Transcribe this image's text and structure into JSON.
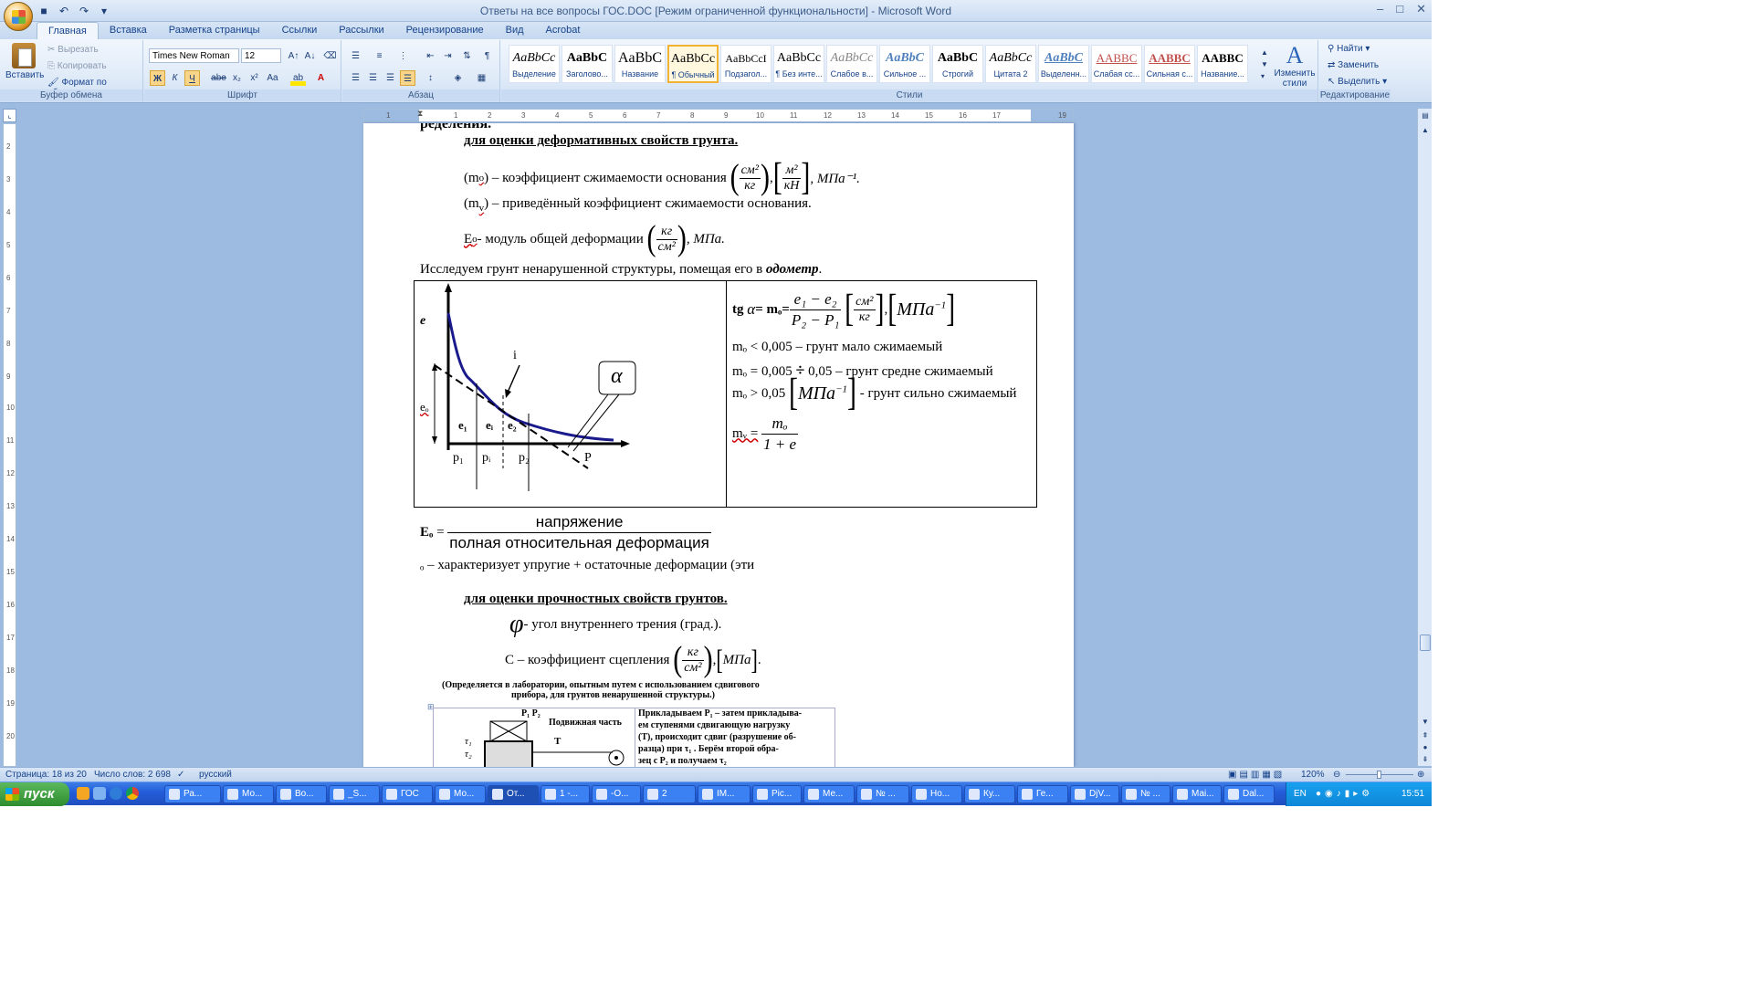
{
  "window": {
    "title": "Ответы на все вопросы ГОС.DOC [Режим ограниченной функциональности] - Microsoft Word"
  },
  "tabs": [
    "Главная",
    "Вставка",
    "Разметка страницы",
    "Ссылки",
    "Рассылки",
    "Рецензирование",
    "Вид",
    "Acrobat"
  ],
  "clipboard": {
    "paste": "Вставить",
    "cut": "Вырезать",
    "copy": "Копировать",
    "format": "Формат по образцу",
    "title": "Буфер обмена"
  },
  "font": {
    "name": "Times New Roman",
    "size": "12",
    "title": "Шрифт",
    "bold": "Ж",
    "italic": "К",
    "underline": "Ч",
    "strike": "abe",
    "sub": "x₂",
    "sup": "x²",
    "case": "Aa"
  },
  "paragraph": {
    "title": "Абзац"
  },
  "styles": {
    "title": "Стили",
    "items": [
      {
        "preview": "AaBbCc",
        "name": "Выделение"
      },
      {
        "preview": "AaBbC",
        "name": "Заголово..."
      },
      {
        "preview": "AaBbC",
        "name": "Название"
      },
      {
        "preview": "AaBbCc",
        "name": "¶ Обычный"
      },
      {
        "preview": "AaBbCcI",
        "name": "Подзагол..."
      },
      {
        "preview": "AaBbCc",
        "name": "¶ Без инте..."
      },
      {
        "preview": "AaBbCc",
        "name": "Слабое в..."
      },
      {
        "preview": "AaBbC",
        "name": "Сильное ..."
      },
      {
        "preview": "AaBbC",
        "name": "Строгий"
      },
      {
        "preview": "AaBbCc",
        "name": "Цитата 2"
      },
      {
        "preview": "AaBbC",
        "name": "Выделенн..."
      },
      {
        "preview": "AABBC",
        "name": "Слабая сс..."
      },
      {
        "preview": "AABBC",
        "name": "Сильная с..."
      },
      {
        "preview": "AABBC",
        "name": "Название..."
      }
    ],
    "change": "Изменить стили"
  },
  "editing": {
    "find": "Найти",
    "replace": "Заменить",
    "select": "Выделить",
    "title": "Редактирование"
  },
  "doc": {
    "top_cut": "ределения.",
    "h_deform": "для оценки деформативных свойств грунта.",
    "m0": "(m",
    "m0_sub": "o",
    "m0_text": ") – коэффициент сжимаемости основания",
    "u_sm2": "см²",
    "u_kg": "кг",
    "u_m2": "м²",
    "u_kn": "кН",
    "mpa_inv": ", МПа⁻¹.",
    "mv": "(m",
    "mv_sub": "v",
    "mv_text": ") – приведённый коэффициент сжимаемости основания.",
    "e0": "E",
    "e0_sub": "o",
    "e0_text": " - модуль общей деформации",
    "mpa": ", МПа.",
    "study": "Исследуем грунт ненарушенной структуры, помещая его в ",
    "odometer": "одометр",
    "fig_e": "e",
    "fig_i": "i",
    "fig_e0": "eₒ",
    "fig_e1": "e₁",
    "fig_ei": "eᵢ",
    "fig_e2": "e₂",
    "fig_p1": "p₁",
    "fig_pi": "pᵢ",
    "fig_p2": "p₂",
    "fig_P": "P",
    "fig_alpha": "α",
    "tg": "tg",
    "alpha": "α",
    "eq_m0": " = mₒ=",
    "f_num": "e₁ − e₂",
    "f_den": "P₂ − P₁",
    "r1": "mₒ < 0,005 – грунт мало сжимаемый",
    "r2a": "mₒ = 0,005",
    "r2b": "0,05 – грунт средне сжимаемый",
    "r3a": "mₒ > 0,05",
    "r3b": "- грунт сильно сжимаемый",
    "mv_eq": "mᵥ =",
    "mv_num": "mₒ",
    "mv_den": "1 + e",
    "E0b": "Eₒ",
    "E_num": "напряжение",
    "E_den": "полная относительная деформация",
    "e0_note": "ₒ – характеризует упругие + остаточные деформации (эти",
    "h_strength": "для оценки прочностных свойств грунтов.",
    "phi": "φ",
    "phi_text": " - угол внутреннего трения (град.).",
    "c_text": "C – коэффициент сцепления",
    "mpa_b": "МПа",
    "lab1": "(Определяется в лаборатории, опытным путем с использованием сдвигового",
    "lab2": "прибора, для грунтов ненарушенной структуры.)",
    "p12": "P₁ P₂",
    "moving": "Подвижная часть",
    "t1": "τ₁",
    "t2": "τ₂",
    "T": "T",
    "apply1": "Прикладываем P₁ – затем прикладыва-",
    "apply2": "ем ступенями сдвигающую нагрузку",
    "apply3": "(T), происходит сдвиг (разрушение об-",
    "apply4": "разца) при   τ₁  . Берём второй обра-",
    "apply5": "зец с P₂ и получаем  τ₂"
  },
  "status": {
    "page": "Страница: 18 из 20",
    "words": "Число слов: 2 698",
    "lang": "русский",
    "zoom": "120%"
  },
  "taskbar": {
    "start": "пуск",
    "items": [
      "Ра...",
      "Мо...",
      "Во...",
      "_S...",
      "ГОС",
      "Мо...",
      "От...",
      "1 -...",
      "-О...",
      "2",
      "IM...",
      "Ріс...",
      "Ме...",
      "№ ...",
      "Но...",
      "Ку...",
      "Ге...",
      "DjV...",
      "№ ...",
      "Маі...",
      "Dal..."
    ],
    "lang": "EN",
    "time": "15:51"
  }
}
